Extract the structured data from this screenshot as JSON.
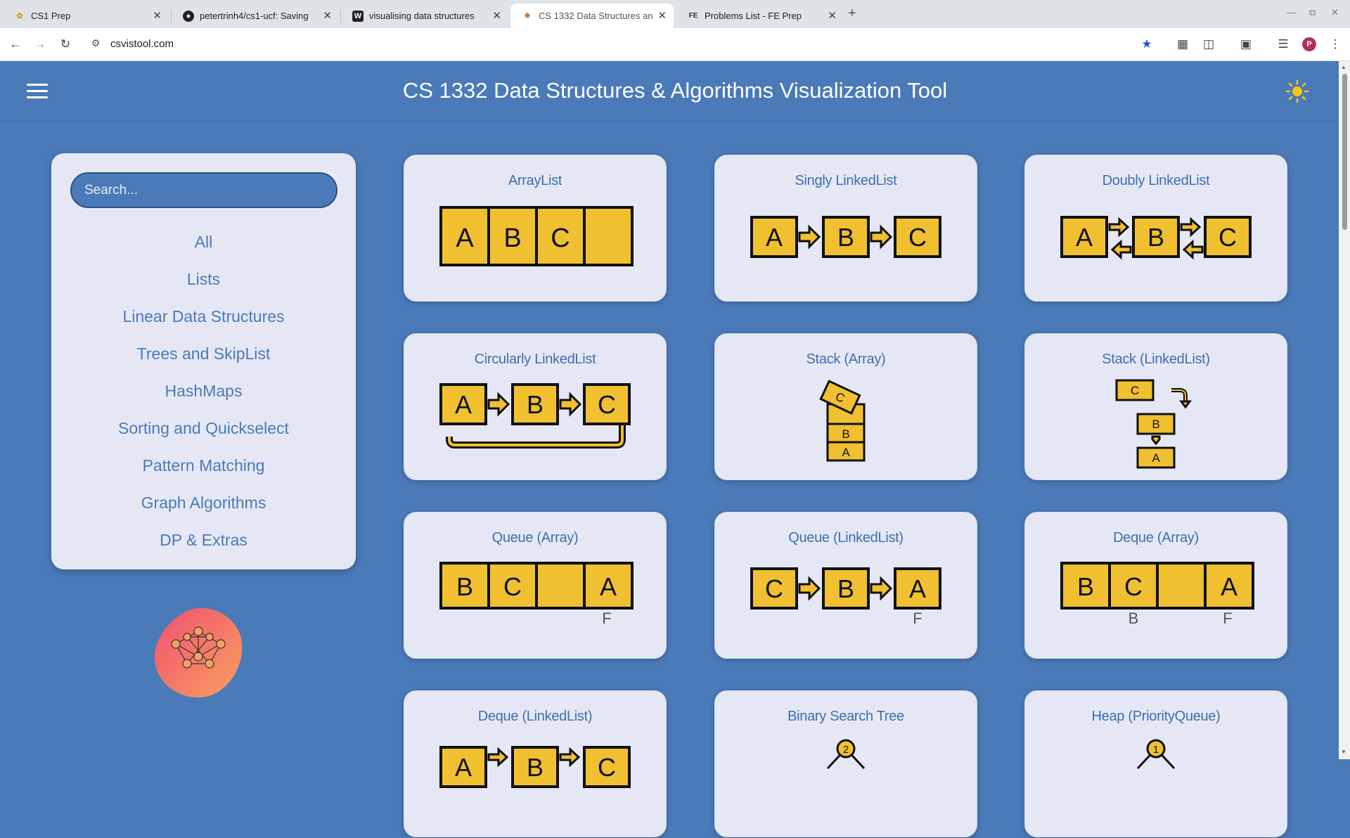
{
  "browser": {
    "tabs": [
      {
        "label": "CS1 Prep",
        "icon": "leaf-icon"
      },
      {
        "label": "petertrinh4/cs1-ucf: Saving",
        "icon": "github-icon"
      },
      {
        "label": "visualising data structures",
        "icon": "w-icon"
      },
      {
        "label": "CS 1332 Data Structures an",
        "icon": "app-icon",
        "active": true
      },
      {
        "label": "Problems List - FE Prep",
        "icon": "fe-icon"
      }
    ],
    "url": "csvistool.com"
  },
  "app": {
    "title": "CS 1332 Data Structures & Algorithms Visualization Tool",
    "search_placeholder": "Search...",
    "categories": [
      "All",
      "Lists",
      "Linear Data Structures",
      "Trees and SkipList",
      "HashMaps",
      "Sorting and Quickselect",
      "Pattern Matching",
      "Graph Algorithms",
      "DP & Extras"
    ]
  },
  "cards": [
    {
      "title": "ArrayList",
      "cells": [
        "A",
        "B",
        "C",
        ""
      ]
    },
    {
      "title": "Singly LinkedList",
      "nodes": [
        "A",
        "B",
        "C"
      ]
    },
    {
      "title": "Doubly LinkedList",
      "nodes": [
        "A",
        "B",
        "C"
      ]
    },
    {
      "title": "Circularly LinkedList",
      "nodes": [
        "A",
        "B",
        "C"
      ]
    },
    {
      "title": "Stack (Array)",
      "items": [
        "C",
        "B",
        "A"
      ]
    },
    {
      "title": "Stack (LinkedList)",
      "items": [
        "C",
        "B",
        "A"
      ]
    },
    {
      "title": "Queue (Array)",
      "cells": [
        "B",
        "C",
        "",
        "A"
      ],
      "pointers": [
        "F"
      ]
    },
    {
      "title": "Queue (LinkedList)",
      "nodes": [
        "C",
        "B",
        "A"
      ],
      "pointers": [
        "F"
      ]
    },
    {
      "title": "Deque (Array)",
      "cells": [
        "B",
        "C",
        "",
        "A"
      ],
      "pointers": [
        "B",
        "F"
      ]
    },
    {
      "title": "Deque (LinkedList)",
      "nodes": [
        "A",
        "B",
        "C"
      ]
    },
    {
      "title": "Binary Search Tree",
      "root": "2"
    },
    {
      "title": "Heap (PriorityQueue)",
      "root": "1"
    }
  ],
  "colors": {
    "accent": "#4a7ab8",
    "cell_fill": "#f0c030",
    "card_bg": "#e5e8f4",
    "title_text": "#3e6fb0"
  }
}
